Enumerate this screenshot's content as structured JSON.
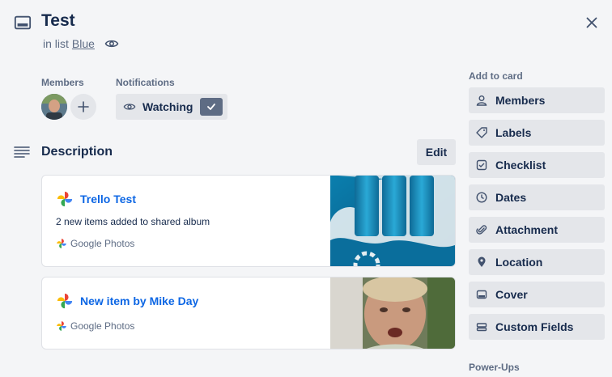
{
  "card": {
    "title": "Test",
    "in_list_prefix": "in list",
    "list_name": "Blue"
  },
  "members": {
    "label": "Members"
  },
  "notifications": {
    "label": "Notifications",
    "watch_label": "Watching"
  },
  "description": {
    "title": "Description",
    "edit_label": "Edit"
  },
  "embeds": [
    {
      "title": "Trello Test",
      "body": "2 new items added to shared album",
      "source": "Google Photos"
    },
    {
      "title": "New item by Mike Day",
      "source": "Google Photos"
    }
  ],
  "sidebar": {
    "add_to_card_label": "Add to card",
    "buttons": [
      {
        "label": "Members",
        "icon": "person-icon"
      },
      {
        "label": "Labels",
        "icon": "tag-icon"
      },
      {
        "label": "Checklist",
        "icon": "checklist-icon"
      },
      {
        "label": "Dates",
        "icon": "clock-icon"
      },
      {
        "label": "Attachment",
        "icon": "paperclip-icon"
      },
      {
        "label": "Location",
        "icon": "pin-icon"
      },
      {
        "label": "Cover",
        "icon": "cover-icon"
      },
      {
        "label": "Custom Fields",
        "icon": "custom-fields-icon"
      }
    ],
    "powerups_label": "Power-Ups"
  },
  "colors": {
    "background": "#f4f5f7",
    "text": "#172b4d",
    "muted": "#5e6c84",
    "button": "#e4e6ea",
    "link": "#0c66e4"
  }
}
